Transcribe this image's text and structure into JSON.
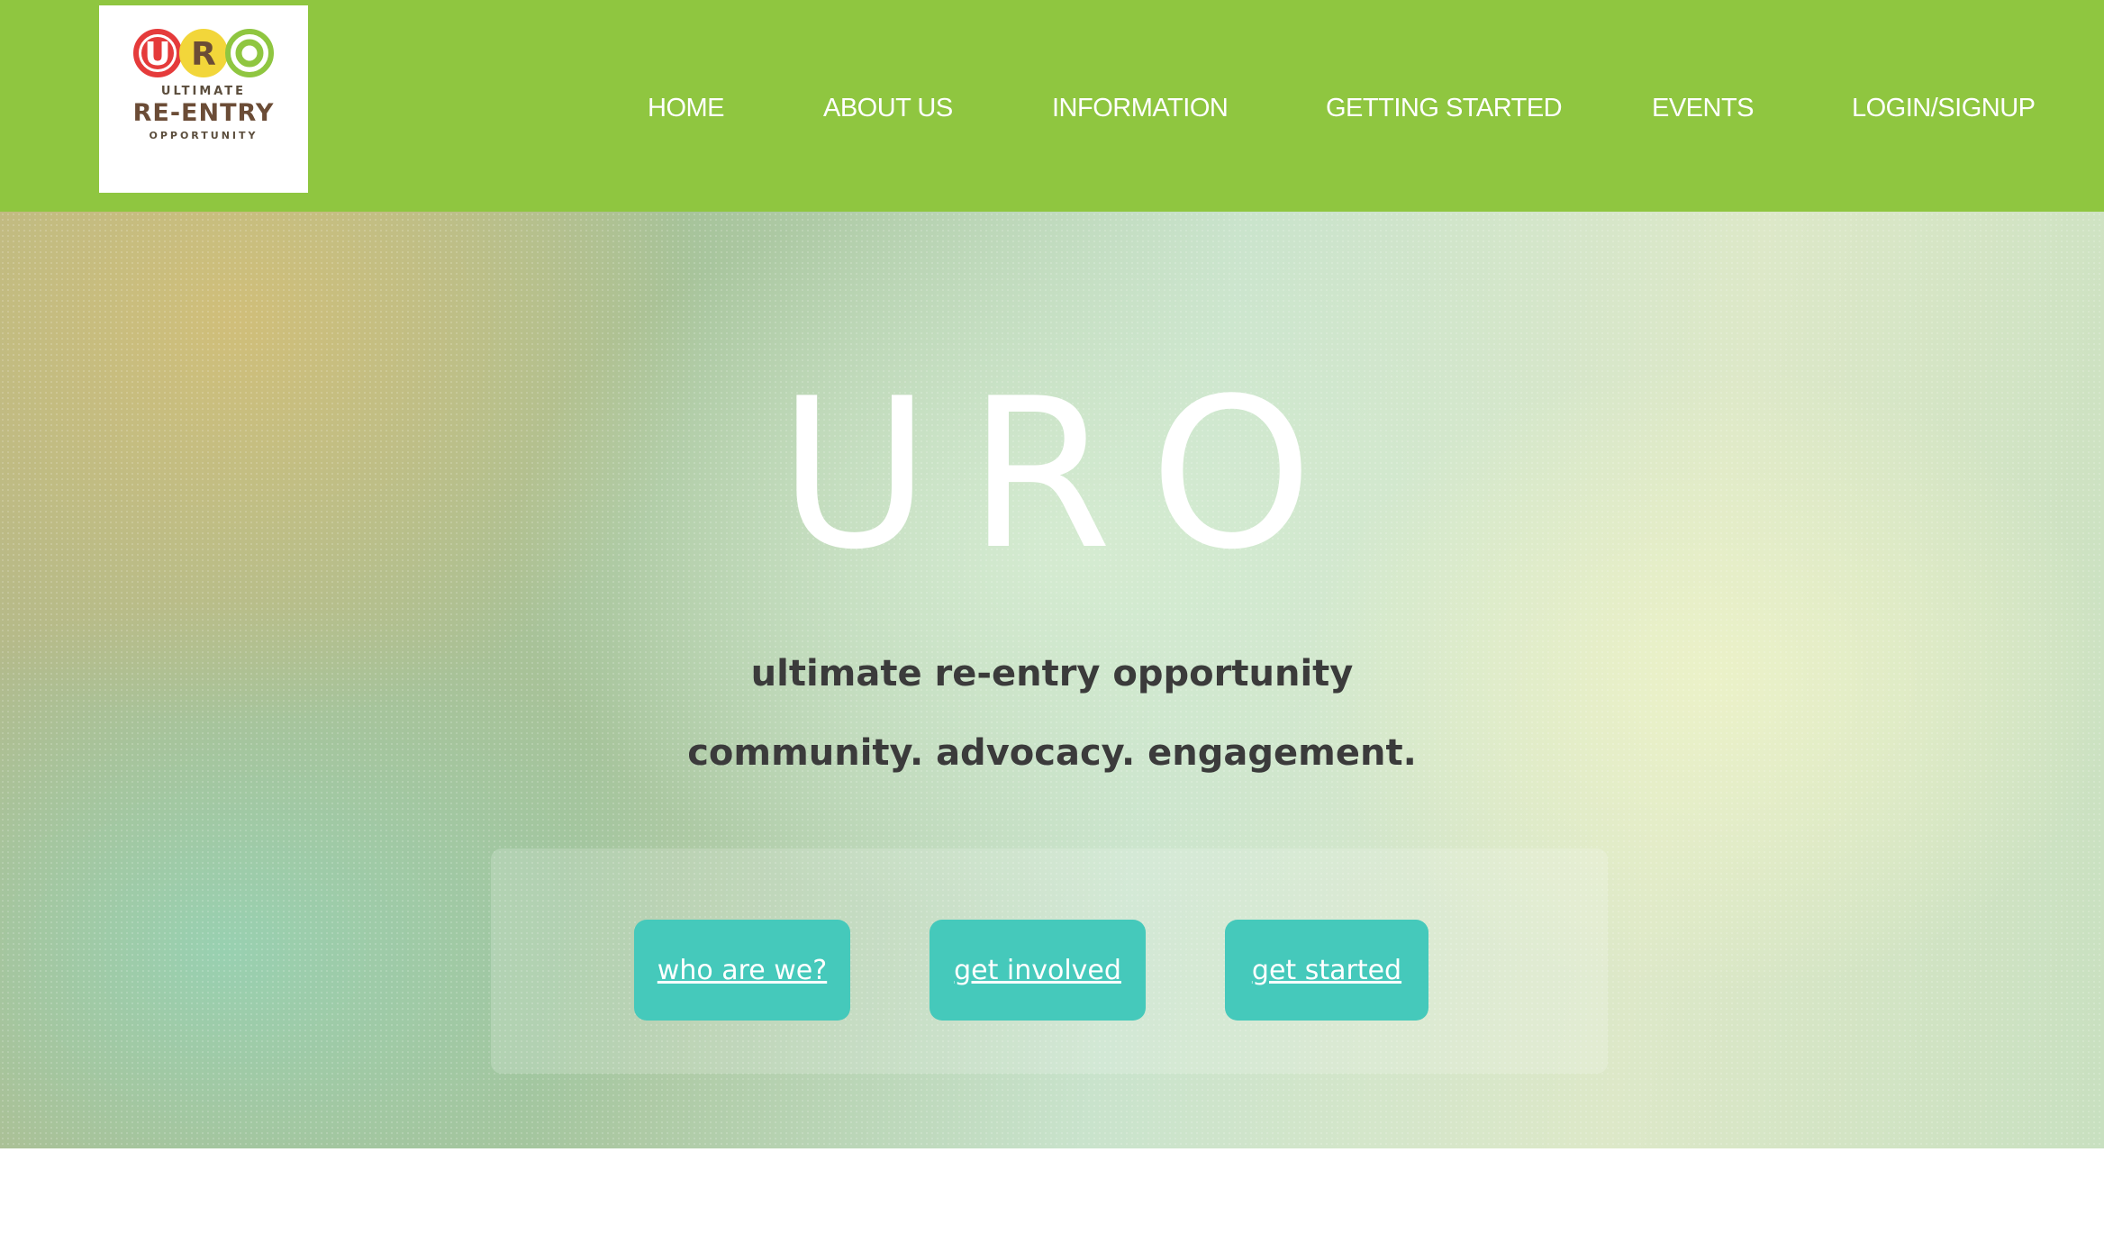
{
  "logo": {
    "letters": [
      "U",
      "R",
      "O"
    ],
    "line1": "ULTIMATE",
    "line2": "RE-ENTRY",
    "line3": "OPPORTUNITY",
    "colors": {
      "u": "#e53b3b",
      "r": "#f2d63a",
      "o": "#8fc640",
      "text": "#6b4c36"
    }
  },
  "nav": {
    "items": [
      "HOME",
      "ABOUT US",
      "INFORMATION",
      "GETTING STARTED",
      "EVENTS",
      "LOGIN/SIGNUP"
    ]
  },
  "hero": {
    "title": "URO",
    "subtitle": "ultimate re-entry opportunity",
    "tagline": "community. advocacy. engagement.",
    "buttons": [
      "who are we?",
      "get involved",
      "get started"
    ]
  },
  "colors": {
    "header": "#8fc640",
    "button": "#45c9bb",
    "heading_text": "#3b3b3b"
  }
}
